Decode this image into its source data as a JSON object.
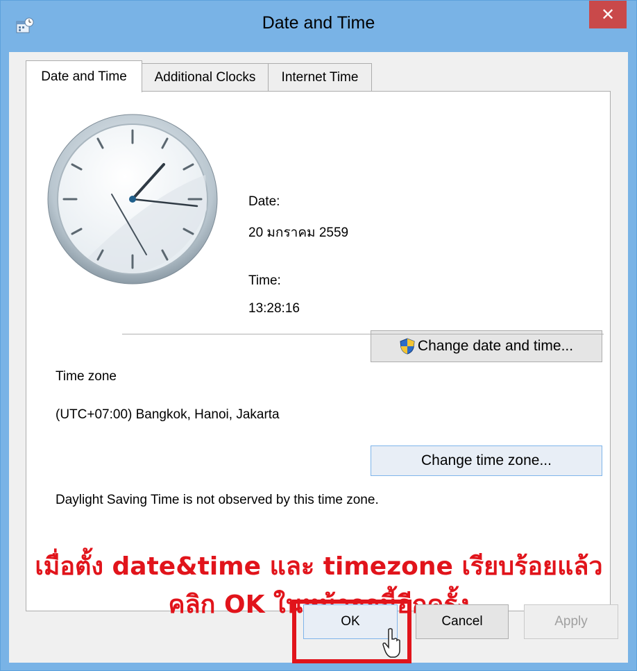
{
  "window": {
    "title": "Date and Time",
    "close_label": "✕"
  },
  "tabs": [
    {
      "label": "Date and Time",
      "active": true
    },
    {
      "label": "Additional Clocks",
      "active": false
    },
    {
      "label": "Internet Time",
      "active": false
    }
  ],
  "date": {
    "label": "Date:",
    "value": "20 มกราคม 2559"
  },
  "time": {
    "label": "Time:",
    "value": "13:28:16"
  },
  "buttons": {
    "change_date_time": "Change date and time...",
    "change_time_zone": "Change time zone...",
    "ok": "OK",
    "cancel": "Cancel",
    "apply": "Apply"
  },
  "timezone": {
    "heading": "Time zone",
    "value": "(UTC+07:00) Bangkok, Hanoi, Jakarta",
    "dst_note": "Daylight Saving Time is not observed by this time zone."
  },
  "annotation": {
    "line1": "เมื่อตั้ง date&time และ timezone เรียบร้อยแล้ว",
    "line2": "คลิก OK ในหน้าจอนี้อีกครั้ง",
    "color": "#e1141b"
  },
  "colors": {
    "titlebar": "#79b3e6",
    "close": "#c9494a"
  },
  "clock_icon": "analog-clock"
}
